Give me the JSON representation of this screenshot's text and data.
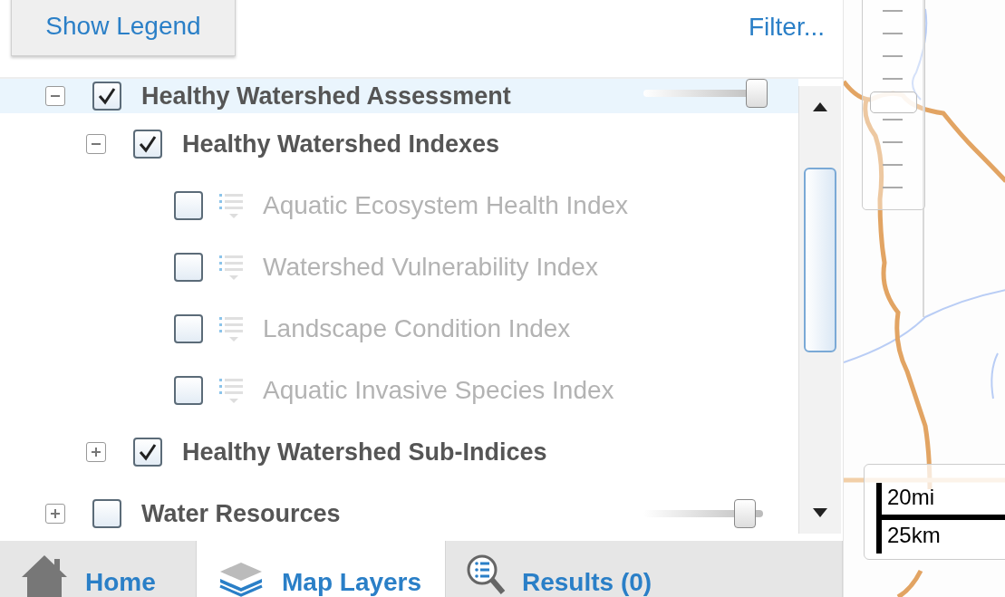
{
  "toolbar": {
    "legend_button": "Show Legend",
    "filter_link": "Filter..."
  },
  "layers": [
    {
      "kind": "group",
      "label": "Healthy Watershed Assessment",
      "expanded": true,
      "checked": true,
      "selected": true,
      "level": 0.95,
      "children": [
        {
          "kind": "group",
          "label": "Healthy Watershed Indexes",
          "expanded": true,
          "checked": true,
          "selected": false,
          "children": [
            {
              "kind": "layer",
              "label": "Aquatic Ecosystem Health Index",
              "checked": false,
              "disabled": true,
              "selected": false
            },
            {
              "kind": "layer",
              "label": "Watershed Vulnerability Index",
              "checked": false,
              "disabled": true,
              "selected": false
            },
            {
              "kind": "layer",
              "label": "Landscape Condition Index",
              "checked": false,
              "disabled": true,
              "selected": false
            },
            {
              "kind": "layer",
              "label": "Aquatic Invasive Species Index",
              "checked": false,
              "disabled": true,
              "selected": false
            }
          ]
        },
        {
          "kind": "group",
          "label": "Healthy Watershed Sub-Indices",
          "expanded": false,
          "checked": true,
          "selected": false
        }
      ]
    },
    {
      "kind": "group",
      "label": "Water Resources",
      "expanded": false,
      "checked": false,
      "selected": false,
      "level": 0.85
    }
  ],
  "tabs": [
    {
      "kind": "home",
      "label": "Home",
      "selected": false
    },
    {
      "kind": "layers",
      "label": "Map Layers",
      "selected": true
    },
    {
      "kind": "results",
      "label": "Results (0)",
      "selected": false
    }
  ],
  "map": {
    "zoom": {
      "level": 0.5
    },
    "scale": [
      {
        "label": "20mi"
      },
      {
        "label": "25km"
      }
    ]
  }
}
